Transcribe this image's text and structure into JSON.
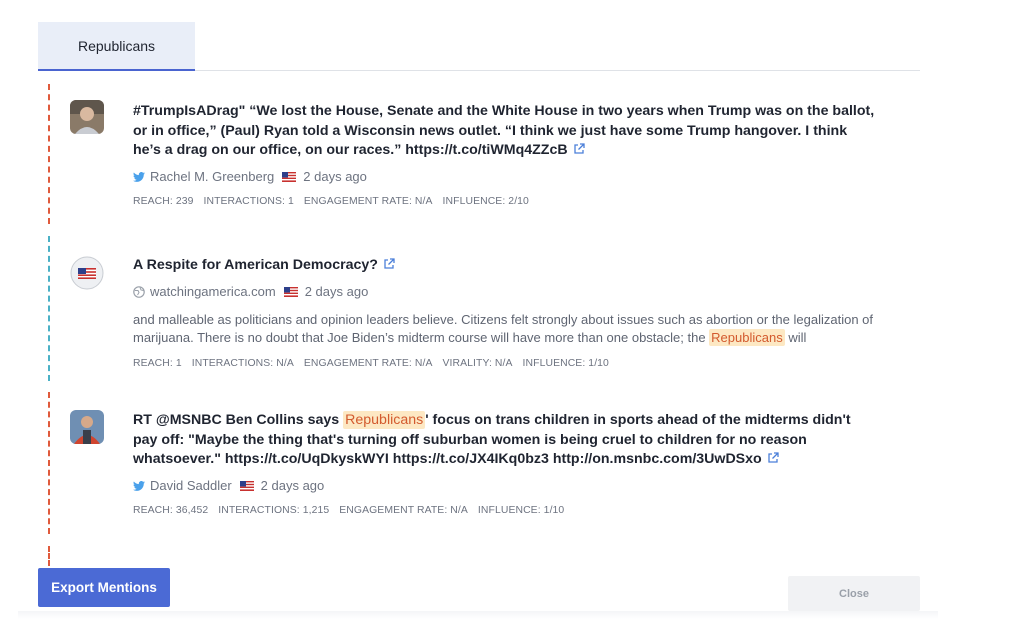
{
  "tabs": [
    {
      "label": "Republicans"
    }
  ],
  "mentions": [
    {
      "title_text": "#TrumpIsADrag\" “We lost the House, Senate and the White House in two years when Trump was on the ballot, or in office,” (Paul) Ryan told a Wisconsin news outlet. “I think we just have some Trump hangover. I think he’s a drag on our office, on our races.” ",
      "title_link": "https://t.co/tiWMq4ZZcB",
      "source_icon": "twitter-icon",
      "author": "Rachel M. Greenberg",
      "flag_icon": "us-flag-icon",
      "time": "2 days ago",
      "stats": [
        "REACH: 239",
        "INTERACTIONS: 1",
        "ENGAGEMENT RATE: N/A",
        "INFLUENCE: 2/10"
      ]
    },
    {
      "title_text": "A Respite for American Democracy?",
      "source_icon": "globe-icon",
      "author": "watchingamerica.com",
      "flag_icon": "us-flag-icon",
      "time": "2 days ago",
      "excerpt_before": "and malleable as politicians and opinion leaders believe. Citizens felt strongly about issues such as abortion or the legalization of marijuana. There is no doubt that Joe Biden’s midterm course will have more than one obstacle; the ",
      "excerpt_highlight": "Republicans",
      "excerpt_after": " will",
      "stats": [
        "REACH: 1",
        "INTERACTIONS: N/A",
        "ENGAGEMENT RATE: N/A",
        "VIRALITY: N/A",
        "INFLUENCE: 1/10"
      ]
    },
    {
      "title_before": "RT @MSNBC Ben Collins says ",
      "title_highlight": "Republicans",
      "title_after": "' focus on trans children in sports ahead of the midterms didn't pay off: \"Maybe the thing that's turning off suburban women is being cruel to children for no reason whatsoever.\" https://t.co/UqDkyskWYI https://t.co/JX4IKq0bz3 http://on.msnbc.com/3UwDSxo",
      "source_icon": "twitter-icon",
      "author": "David Saddler",
      "flag_icon": "us-flag-icon",
      "time": "2 days ago",
      "stats": [
        "REACH: 36,452",
        "INTERACTIONS: 1,215",
        "ENGAGEMENT RATE: N/A",
        "INFLUENCE: 1/10"
      ]
    }
  ],
  "buttons": {
    "export": "Export Mentions",
    "close": "Close"
  },
  "colors": {
    "accent": "#4b6ad5",
    "highlight_bg": "#fde8c3",
    "highlight_text": "#d35a2e",
    "bar_red": "#e05a3c",
    "bar_teal": "#4bb1c6"
  }
}
